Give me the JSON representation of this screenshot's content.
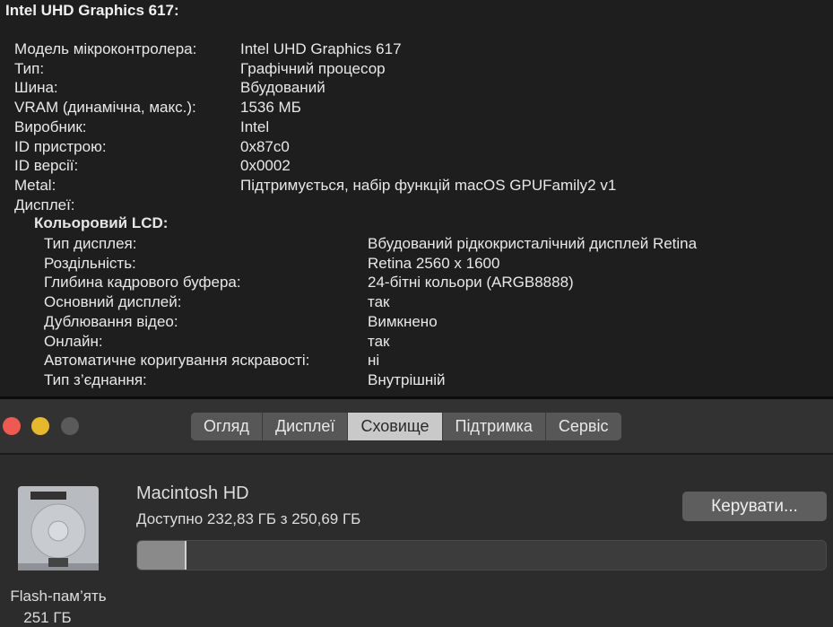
{
  "gpu_title": "Intel UHD Graphics 617:",
  "gpu_info": [
    {
      "k": "Модель мікроконтролера:",
      "v": "Intel UHD Graphics 617"
    },
    {
      "k": "Тип:",
      "v": "Графічний процесор"
    },
    {
      "k": "Шина:",
      "v": "Вбудований"
    },
    {
      "k": "VRAM (динамічна, макс.):",
      "v": "1536 МБ"
    },
    {
      "k": "Виробник:",
      "v": "Intel"
    },
    {
      "k": "ID пристрою:",
      "v": "0x87c0"
    },
    {
      "k": "ID версії:",
      "v": "0x0002"
    },
    {
      "k": "Metal:",
      "v": "Підтримується, набір функцій macOS GPUFamily2 v1"
    },
    {
      "k": "Дисплеї:",
      "v": ""
    }
  ],
  "display_title": "Кольоровий LCD:",
  "display_info": [
    {
      "k": "Тип дисплея:",
      "v": "Вбудований рідкокристалічний дисплей Retina"
    },
    {
      "k": "Роздільність:",
      "v": "Retina 2560 x 1600"
    },
    {
      "k": "Глибина кадрового буфера:",
      "v": "24-бітні кольори (ARGB8888)"
    },
    {
      "k": "Основний дисплей:",
      "v": "так"
    },
    {
      "k": "Дублювання відео:",
      "v": "Вимкнено"
    },
    {
      "k": "Онлайн:",
      "v": "так"
    },
    {
      "k": "Автоматичне коригування яскравості:",
      "v": "ні"
    },
    {
      "k": "Тип з’єднання:",
      "v": "Внутрішній"
    }
  ],
  "tabs": [
    "Огляд",
    "Дисплеї",
    "Сховище",
    "Підтримка",
    "Сервіс"
  ],
  "active_tab": "Сховище",
  "storage": {
    "name": "Macintosh  HD",
    "available": "Доступно 232,83 ГБ з 250,69 ГБ",
    "used_fraction": 0.071,
    "manage_label": "Керувати...",
    "type": "Flash-пам’ять",
    "size": "251 ГБ"
  },
  "colors": {
    "close": "#ee5a52",
    "minimize": "#e6b92b",
    "zoom_disabled": "#5a5a5a"
  }
}
